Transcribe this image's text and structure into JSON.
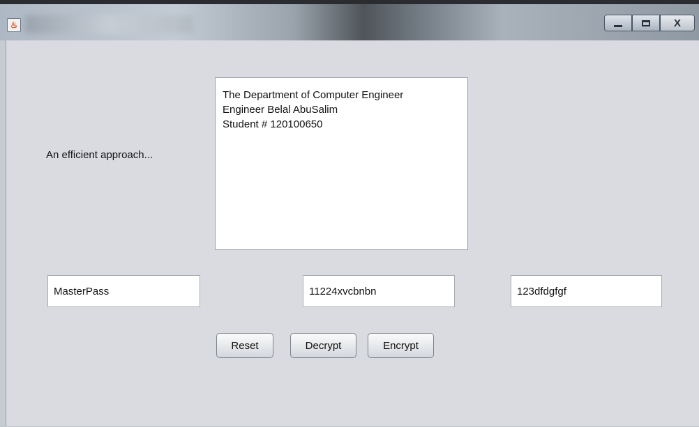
{
  "window": {
    "app_icon_glyph": "♨",
    "controls": {
      "minimize_icon": "minimize-icon",
      "maximize_icon": "maximize-icon",
      "close_label": "X"
    }
  },
  "form": {
    "label": "An efficient approach...",
    "textarea_lines": [
      "The Department of Computer Engineer",
      "Engineer Belal AbuSalim",
      "Student # 120100650"
    ],
    "fields": [
      {
        "value": "MasterPass"
      },
      {
        "value": "11224xvcbnbn"
      },
      {
        "value": "123dfdgfgf"
      }
    ],
    "buttons": {
      "reset": "Reset",
      "decrypt": "Decrypt",
      "encrypt": "Encrypt"
    }
  },
  "colors": {
    "background": "#d9dbe0",
    "field_background": "#ffffff",
    "text": "#111111"
  }
}
